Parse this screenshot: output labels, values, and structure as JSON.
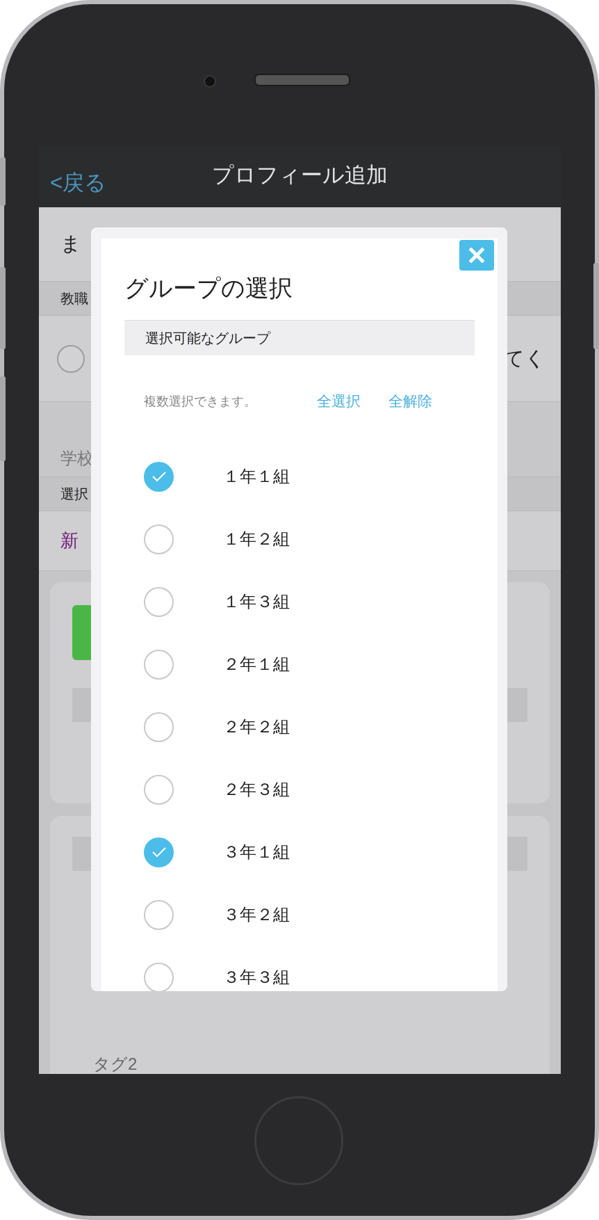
{
  "nav_bar": {
    "back": "<戻る",
    "title": "プロフィール追加"
  },
  "background": {
    "name_row": "ま",
    "section_1": "教職",
    "option_row": {
      "text": "てく",
      "checked": false
    },
    "school_label": "学校",
    "section_2": "選択",
    "new_link": "新",
    "tag_label": "タグ2"
  },
  "dialog": {
    "title": "グループの選択",
    "section": "選択可能なグループ",
    "hint": "複数選択できます。",
    "select_all": "全選択",
    "deselect_all": "全解除",
    "groups": [
      {
        "label": "１年１組",
        "checked": true
      },
      {
        "label": "１年２組",
        "checked": false
      },
      {
        "label": "１年３組",
        "checked": false
      },
      {
        "label": "２年１組",
        "checked": false
      },
      {
        "label": "２年２組",
        "checked": false
      },
      {
        "label": "２年３組",
        "checked": false
      },
      {
        "label": "３年１組",
        "checked": true
      },
      {
        "label": "３年２組",
        "checked": false
      },
      {
        "label": "３年３組",
        "checked": false
      }
    ]
  }
}
